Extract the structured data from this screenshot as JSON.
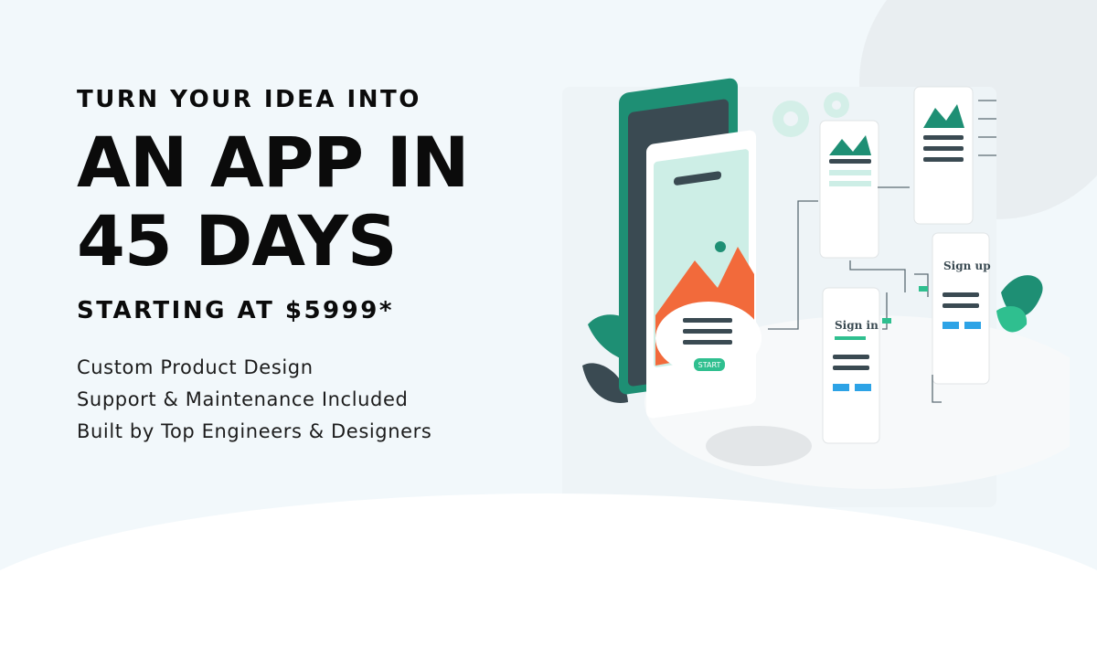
{
  "hero": {
    "pre_headline": "TURN YOUR IDEA INTO",
    "headline_line1": "AN APP IN",
    "headline_line2": "45 DAYS",
    "price_line": "STARTING AT $5999*",
    "features": [
      "Custom Product Design",
      "Support & Maintenance Included",
      "Built by Top Engineers & Designers"
    ]
  },
  "illustration": {
    "start_button": "START",
    "signin_title": "Sign in",
    "signup_title": "Sign up",
    "colors": {
      "teal": "#1e8f74",
      "teal_light": "#cdeee6",
      "orange": "#f26a3b",
      "slate": "#3a4a52",
      "blue": "#2da3e6",
      "accent_green": "#2fbf8f"
    }
  }
}
